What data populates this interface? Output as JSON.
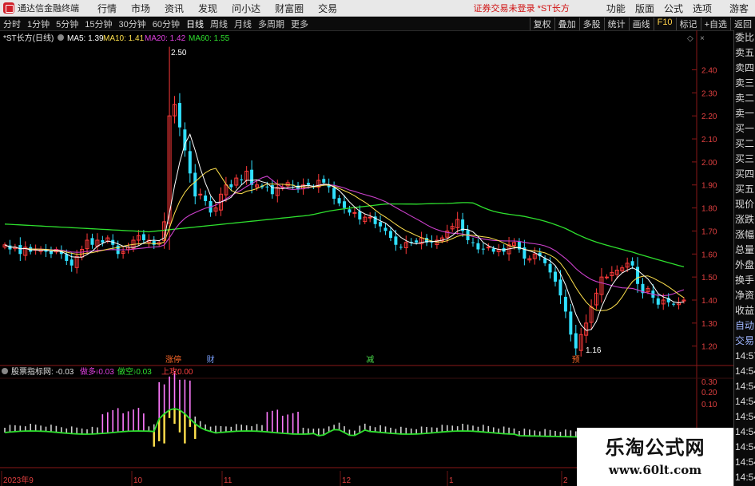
{
  "menubar": {
    "app_title": "通达信金融终端",
    "menus": [
      "行情",
      "市场",
      "资讯",
      "发现",
      "问小达",
      "财富圈",
      "交易"
    ],
    "notice": "证券交易未登录 *ST长方",
    "right_items": [
      "功能",
      "版面",
      "公式",
      "选项"
    ],
    "guest": "游客"
  },
  "toolbar": {
    "periods": [
      "分时",
      "1分钟",
      "5分钟",
      "15分钟",
      "30分钟",
      "60分钟",
      "日线",
      "周线",
      "月线",
      "多周期",
      "更多"
    ],
    "active_period": "日线",
    "right_tools": [
      "复权",
      "叠加",
      "多股",
      "统计",
      "画线",
      "F10",
      "标记",
      "+自选",
      "返回"
    ]
  },
  "chart": {
    "stock_label": "*ST长方(日线)",
    "ma_legend": [
      {
        "label": "MA5: 1.39",
        "color": "#ffffff"
      },
      {
        "label": "MA10: 1.41",
        "color": "#ffe14d"
      },
      {
        "label": "MA20: 1.42",
        "color": "#e040e0"
      },
      {
        "label": "MA60: 1.55",
        "color": "#2ee02e"
      }
    ],
    "colors": {
      "up": "#ff3a3a",
      "down": "#30e0ff",
      "ma5": "#ffffff",
      "ma10": "#ffe14d",
      "ma20": "#cc40cc",
      "ma60": "#2ee02e",
      "grid": "#8a1818"
    },
    "y_axis": {
      "min": 1.14,
      "max": 2.53,
      "ticks": [
        "2.40",
        "2.30",
        "2.20",
        "2.10",
        "2.00",
        "1.90",
        "1.80",
        "1.70",
        "1.60",
        "1.50",
        "1.40",
        "1.30",
        "1.20"
      ]
    },
    "high_label": "2.50",
    "low_label": "1.16",
    "event_markers": [
      {
        "text": "涨停",
        "color": "#ff6a2a",
        "index": 32
      },
      {
        "text": "财",
        "color": "#7aa0ff",
        "index": 40
      },
      {
        "text": "减",
        "color": "#4adf4a",
        "index": 71
      },
      {
        "text": "预",
        "color": "#ff6a2a",
        "index": 111
      }
    ]
  },
  "chart_data": {
    "type": "candlestick",
    "title": "*ST长方(日线)",
    "x_labels": [
      "2023年9",
      "10",
      "11",
      "12",
      "1",
      "2"
    ],
    "high": 2.5,
    "low": 1.16,
    "series": [
      {
        "name": "MA5",
        "last": 1.39
      },
      {
        "name": "MA10",
        "last": 1.41
      },
      {
        "name": "MA20",
        "last": 1.42
      },
      {
        "name": "MA60",
        "last": 1.55
      }
    ],
    "closes": [
      1.64,
      1.62,
      1.63,
      1.6,
      1.63,
      1.61,
      1.62,
      1.62,
      1.61,
      1.6,
      1.62,
      1.6,
      1.57,
      1.55,
      1.59,
      1.62,
      1.66,
      1.64,
      1.66,
      1.65,
      1.67,
      1.64,
      1.6,
      1.61,
      1.63,
      1.66,
      1.68,
      1.66,
      1.66,
      1.64,
      1.65,
      1.74,
      2.2,
      2.25,
      2.15,
      2.05,
      1.95,
      1.85,
      1.86,
      1.83,
      1.78,
      1.8,
      1.86,
      1.9,
      1.89,
      1.93,
      1.92,
      1.96,
      1.9,
      1.9,
      1.89,
      1.89,
      1.86,
      1.89,
      1.89,
      1.91,
      1.9,
      1.88,
      1.9,
      1.9,
      1.89,
      1.92,
      1.91,
      1.89,
      1.84,
      1.82,
      1.8,
      1.78,
      1.78,
      1.75,
      1.76,
      1.76,
      1.73,
      1.72,
      1.7,
      1.67,
      1.64,
      1.63,
      1.65,
      1.65,
      1.65,
      1.67,
      1.65,
      1.65,
      1.66,
      1.67,
      1.7,
      1.72,
      1.75,
      1.7,
      1.66,
      1.65,
      1.62,
      1.62,
      1.63,
      1.61,
      1.62,
      1.61,
      1.64,
      1.65,
      1.62,
      1.58,
      1.58,
      1.6,
      1.59,
      1.56,
      1.52,
      1.48,
      1.42,
      1.35,
      1.25,
      1.19,
      1.25,
      1.3,
      1.37,
      1.43,
      1.5,
      1.5,
      1.52,
      1.53,
      1.54,
      1.56,
      1.55,
      1.47,
      1.43,
      1.45,
      1.41,
      1.38,
      1.4,
      1.39,
      1.38,
      1.39,
      1.4
    ],
    "indicator": {
      "name": "股票指标网",
      "values": {
        "cash_long": "-0.03",
        "bull": "-0.03",
        "bear": "-0.03",
        "up": "0.00"
      }
    },
    "indicator_y_ticks": [
      "0.30",
      "0.20",
      "0.10"
    ]
  },
  "indicator_panel": {
    "title": "股票指标网",
    "pairs": [
      {
        "label": "",
        "value": ": -0.03",
        "color": "#dddddd"
      },
      {
        "label": "做多:",
        "value": " -0.03",
        "color": "#e040e0"
      },
      {
        "label": "做空:",
        "value": " -0.03",
        "color": "#30e030"
      },
      {
        "label": "上攻:",
        "value": " 0.00",
        "color": "#ff4040"
      }
    ]
  },
  "right_panel": {
    "items": [
      "委比",
      "卖五",
      "卖四",
      "卖三",
      "卖二",
      "卖一",
      "买一",
      "买二",
      "买三",
      "买四",
      "买五",
      "现价",
      "涨跌",
      "涨幅",
      "总量",
      "外盘",
      "换手",
      "净资",
      "收益",
      "自动",
      "交易",
      "14:57",
      "14:54",
      "14:54",
      "14:54",
      "14:54",
      "14:54",
      "14:54",
      "14:54",
      "14:54"
    ],
    "blue_items": [
      "自动",
      "交易"
    ]
  },
  "watermark": {
    "title": "乐淘公式网",
    "url": "www.60lt.com"
  }
}
